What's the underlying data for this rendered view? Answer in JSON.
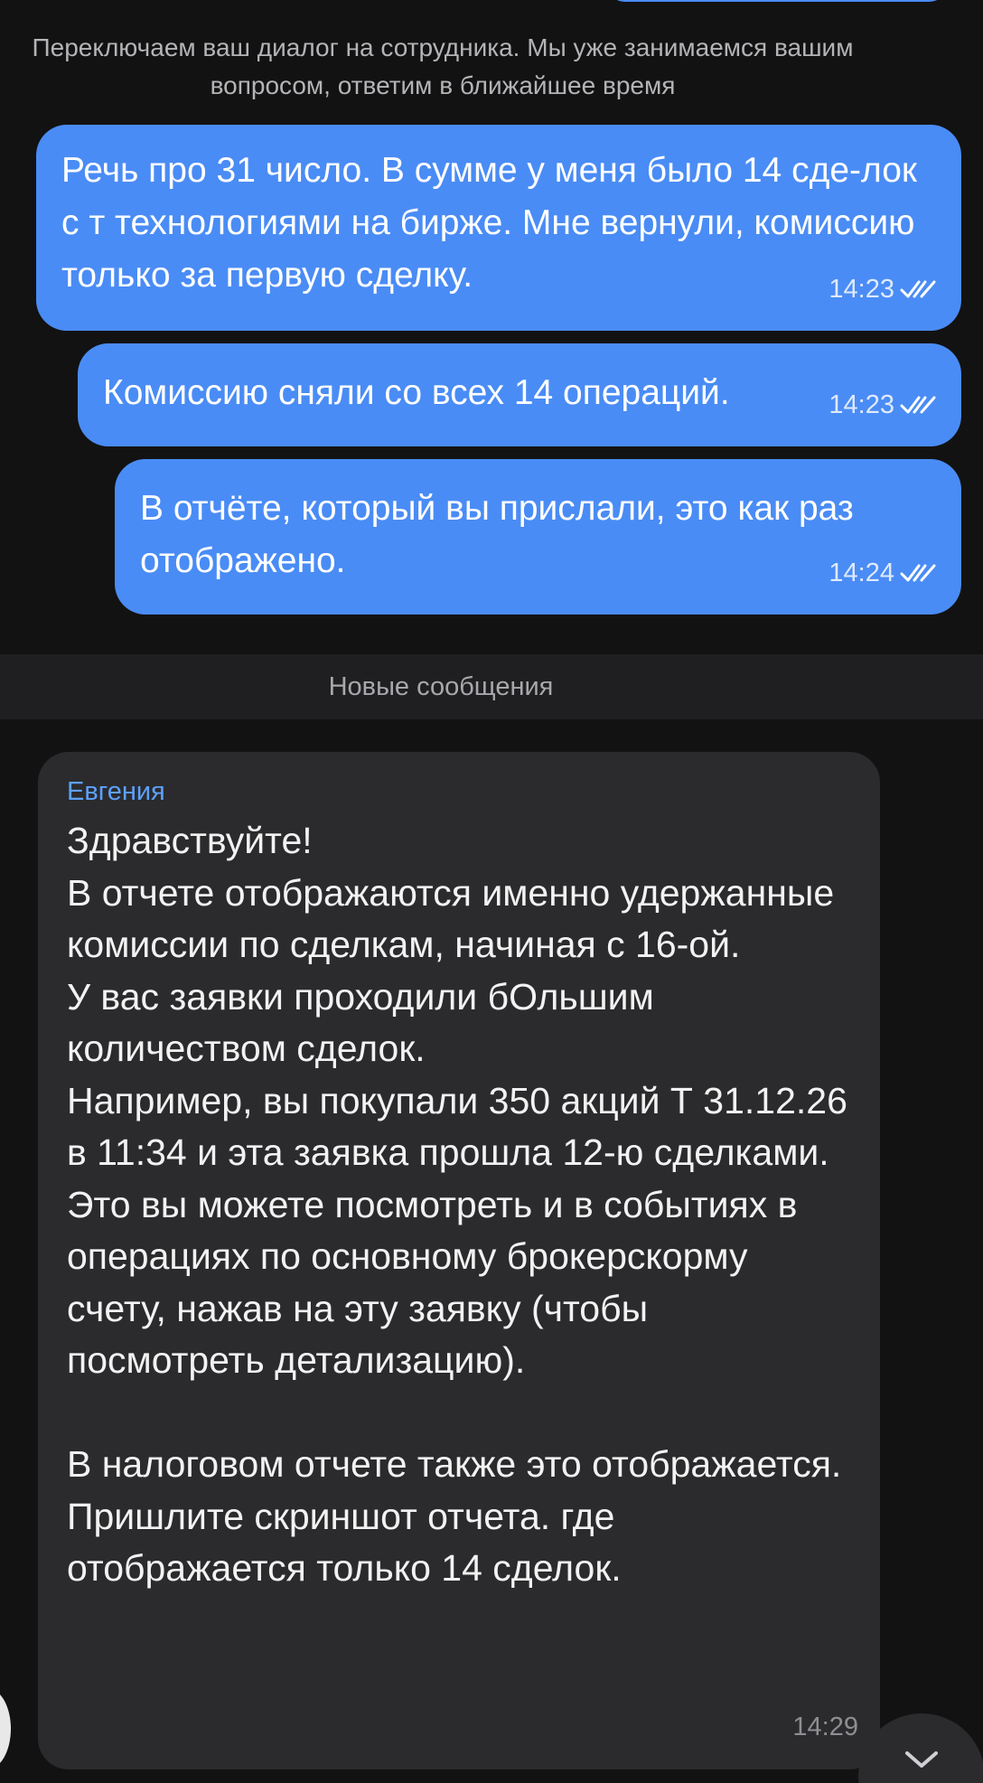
{
  "system_note": "Переключаем ваш диалог на сотрудника. Мы уже занимаемся вашим вопросом, ответим в ближайшее время",
  "outgoing": [
    {
      "text": "Речь про 31 число. В сумме у меня было 14 сде-лок с т технологиями на бирже. Мне вернули, комиссию только за первую сделку.",
      "time": "14:23"
    },
    {
      "text": "Комиссию сняли со всех 14 операций.",
      "time": "14:23"
    },
    {
      "text": "В отчёте, который вы прислали, это как раз отображено.",
      "time": "14:24"
    }
  ],
  "new_messages_label": "Новые сообщения",
  "incoming": {
    "sender": "Евгения",
    "text": "Здравствуйте!\nВ отчете отображаются именно удержанные комиссии по сделкам, начиная с 16-ой.\nУ вас заявки проходили бОльшим количеством сделок.\nНапример, вы покупали 350 акций Т 31.12.26 в 11:34 и эта заявка прошла 12-ю сделками.\nЭто вы можете посмотреть и в событиях в операциях по основному брокерскорму счету, нажав на эту заявку (чтобы посмотреть детализацию).\n\nВ налоговом отчете также это отображается.\nПришлите скриншот отчета. где отображается только 14 сделок.",
    "time": "14:29"
  },
  "colors": {
    "background": "#121212",
    "outgoing_bubble": "#4a8cf5",
    "incoming_bubble": "#2b2b2d",
    "sender_name": "#5ea1ff"
  },
  "icons": {
    "read_receipt": "double-check-icon",
    "scroll_down": "chevron-down-icon"
  }
}
